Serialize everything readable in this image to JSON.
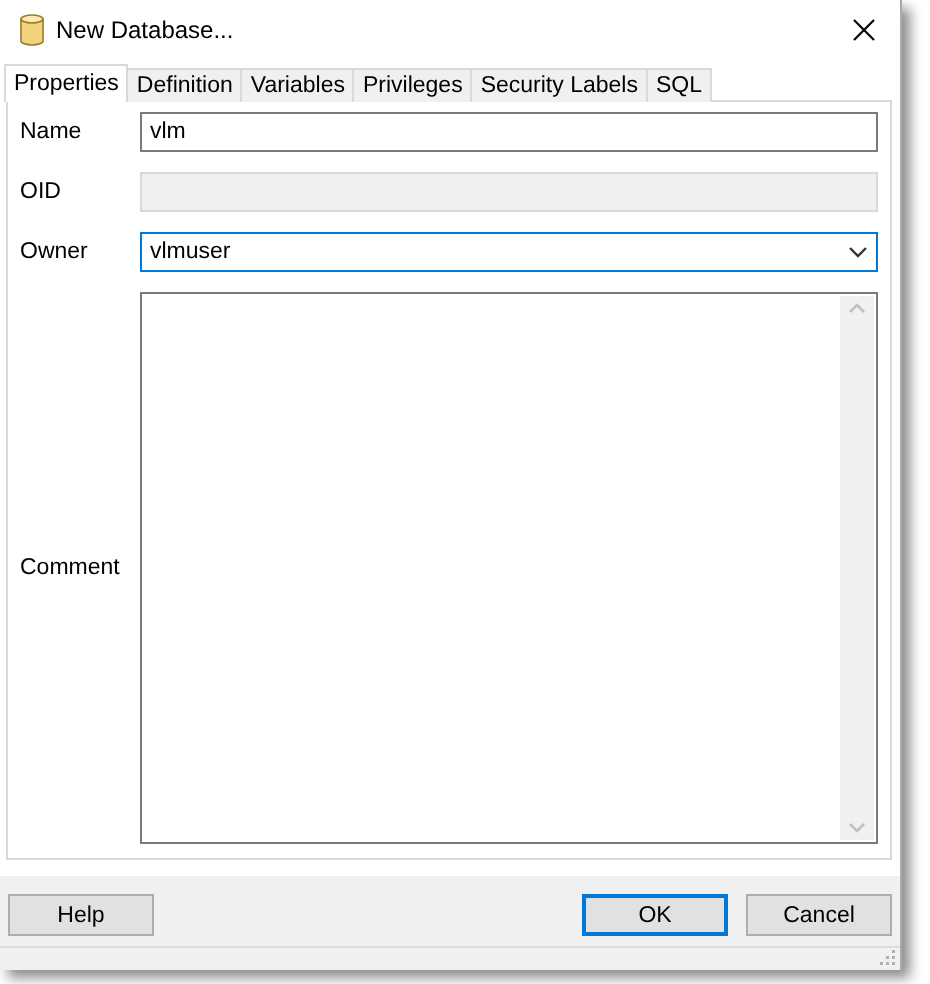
{
  "window": {
    "title": "New Database..."
  },
  "tabs": [
    {
      "label": "Properties",
      "selected": true
    },
    {
      "label": "Definition",
      "selected": false
    },
    {
      "label": "Variables",
      "selected": false
    },
    {
      "label": "Privileges",
      "selected": false
    },
    {
      "label": "Security Labels",
      "selected": false
    },
    {
      "label": "SQL",
      "selected": false
    }
  ],
  "fields": [
    {
      "kind": "text",
      "label": "Name",
      "value": "vlm",
      "disabled": false
    },
    {
      "kind": "text",
      "label": "OID",
      "disabled": true
    },
    {
      "kind": "select",
      "label": "Owner",
      "value": "vlmuser",
      "disabled": false
    },
    {
      "kind": "textarea",
      "label": "Comment",
      "disabled": false
    }
  ],
  "buttons": [
    {
      "label": "Help",
      "default": false
    },
    {
      "label": "OK",
      "default": true
    },
    {
      "label": "Cancel",
      "default": false
    }
  ]
}
